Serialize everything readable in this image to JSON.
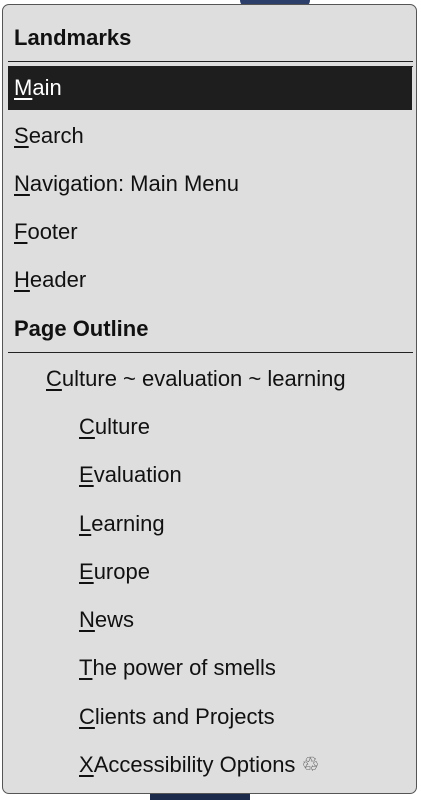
{
  "landmarks": {
    "heading": "Landmarks",
    "items": [
      {
        "key": "M",
        "rest": "ain"
      },
      {
        "key": "S",
        "rest": "earch"
      },
      {
        "key": "N",
        "rest": "avigation: Main Menu"
      },
      {
        "key": "F",
        "rest": "ooter"
      },
      {
        "key": "H",
        "rest": "eader"
      }
    ],
    "selected_index": 0
  },
  "outline": {
    "heading": "Page Outline",
    "items": [
      {
        "key": "C",
        "rest": "ulture ~ evaluation ~ learning",
        "level": 1
      },
      {
        "key": "C",
        "rest": "ulture",
        "level": 2
      },
      {
        "key": "E",
        "rest": "valuation",
        "level": 2
      },
      {
        "key": "L",
        "rest": "earning",
        "level": 2
      },
      {
        "key": "E",
        "rest": "urope",
        "level": 2
      },
      {
        "key": "N",
        "rest": "ews",
        "level": 2
      },
      {
        "key": "T",
        "rest": "he power of smells",
        "level": 2
      },
      {
        "key": "C",
        "rest": "lients and Projects",
        "level": 2
      },
      {
        "key": "X",
        "rest": " Accessibility Options ",
        "level": 2,
        "icon": "recycle-icon",
        "icon_glyph": "♲"
      }
    ]
  }
}
